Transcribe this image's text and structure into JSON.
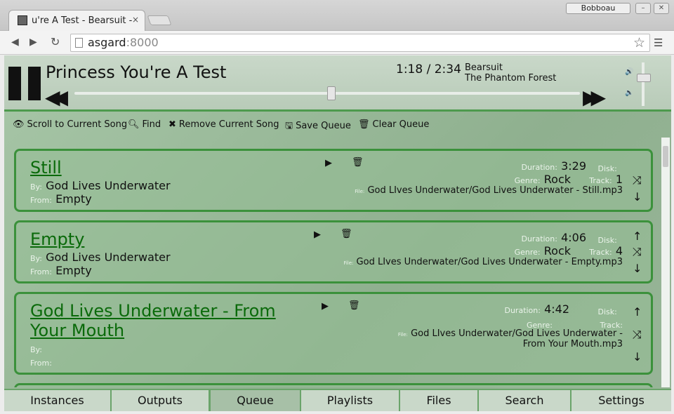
{
  "browser": {
    "tab_title": "u're A Test - Bearsuit - ",
    "tab_close": "×",
    "user_name": "Bobboau",
    "url_host": "asgard",
    "url_port": ":8000"
  },
  "player": {
    "song_title": "Princess You're A Test",
    "time": "1:18 / 2:34",
    "artist": "Bearsuit",
    "album": "The Phantom Forest",
    "progress_fraction": 0.51,
    "volume_fraction": 0.75
  },
  "actions": [
    {
      "icon": "eye-icon",
      "label": "Scroll to Current Song"
    },
    {
      "icon": "search-icon",
      "label": "Find"
    },
    {
      "icon": "remove-icon",
      "label": "Remove Current Song"
    },
    {
      "icon": "save-icon",
      "label": "Save Queue"
    },
    {
      "icon": "trash-icon",
      "label": "Clear Queue"
    }
  ],
  "labels": {
    "by": "By:",
    "from": "From:",
    "duration": "Duration:",
    "disk": "Disk:",
    "genre": "Genre:",
    "track": "Track:",
    "file": "File:"
  },
  "songs": [
    {
      "title": "Still",
      "artist": "God Lives Underwater",
      "album": "Empty",
      "duration": "3:29",
      "genre": "Rock",
      "track": "1",
      "file": "God LIves Underwater/God Lives Underwater - Still.mp3"
    },
    {
      "title": "Empty",
      "artist": "God Lives Underwater",
      "album": "Empty",
      "duration": "4:06",
      "genre": "Rock",
      "track": "4",
      "file": "God LIves Underwater/God Lives Underwater - Empty.mp3"
    },
    {
      "title": "God Lives Underwater - From Your Mouth",
      "artist": "",
      "album": "",
      "duration": "4:42",
      "genre": "",
      "track": "",
      "file": "God LIves Underwater/God Lives Underwater - From Your Mouth.mp3"
    }
  ],
  "tabs": [
    "Instances",
    "Outputs",
    "Queue",
    "Playlists",
    "Files",
    "Search",
    "Settings"
  ],
  "active_tab": "Queue"
}
